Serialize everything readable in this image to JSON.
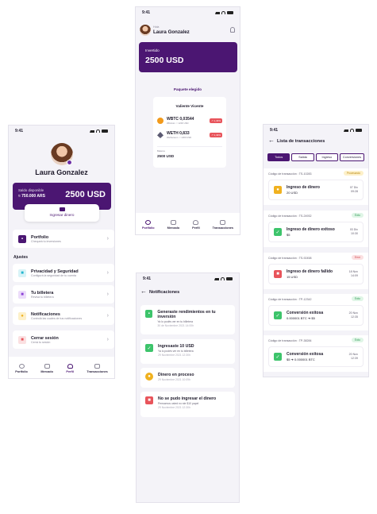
{
  "status_time": "9:41",
  "profile": {
    "name": "Laura Gonzalez",
    "balance_label": "Saldo disponible",
    "balance_ars": "≈ 750.000 ARS",
    "balance_usd": "2500 USD",
    "deposit_label": "Ingresar dinero",
    "portfolio_title": "Portfolio",
    "portfolio_sub": "Chequeá tu inversiones",
    "settings_label": "Ajustes",
    "menu": [
      {
        "title": "Privacidad y Seguridad",
        "sub": "Configurá la seguridad de tu cuenta",
        "color": "#21b5cf"
      },
      {
        "title": "Tu billetera",
        "sub": "Revisá tu billetera",
        "color": "#8a3fd6"
      },
      {
        "title": "Notificaciones",
        "sub": "Controlá las cuales de tus notificaciones",
        "color": "#f0b11f"
      },
      {
        "title": "Cerrar sesión",
        "sub": "Cerrá tu sesión",
        "color": "#e8545b"
      }
    ],
    "tabs": [
      "Portfolio",
      "Mercado",
      "Perfil",
      "Transacciones"
    ]
  },
  "portfolio": {
    "greeting": "Hola",
    "name": "Laura Gonzalez",
    "invested_label": "Invertido",
    "invested_value": "2500 USD",
    "package_label": "Paquete elegido",
    "package_name": "Valiente Vicente",
    "assets": [
      {
        "symbol": "WBTC",
        "name": "Wbitcoin",
        "amount": "0,03544",
        "usd": "≈ 1200 USD",
        "change": "1,43%",
        "color": "#f29a1b"
      },
      {
        "symbol": "WETH",
        "name": "Wethereum",
        "amount": "0,833",
        "usd": "≈ 1300 USD",
        "change": "1,43%",
        "color": "#5b5a72"
      }
    ],
    "total_label": "Balance",
    "total": "2500 USD",
    "tabs": [
      "Portfolio",
      "Mercado",
      "Perfil",
      "Transacciones"
    ]
  },
  "notifications": {
    "title": "Notificaciones",
    "items": [
      {
        "title": "Generaste rendimientos en tu inversión",
        "sub": "Ya lo podés ver en tu billetera",
        "date": "30 de Noviembre 2021 14:00h",
        "color": "#3dc46b"
      },
      {
        "title": "Ingresaste 10 USD",
        "sub": "Ya lo podés ver en tu billetera",
        "date": "29 Noviembre 2021 12:30h",
        "color": "#3dc46b"
      },
      {
        "title": "Dinero en proceso",
        "sub": "",
        "date": "29 Noviembre 2021 10:09h",
        "color": "#f0b11f"
      },
      {
        "title": "No se pudo ingresar el dinero",
        "sub": "Pensamos usted no ste $10 papel",
        "date": "29 Noviembre 2021 12:30h",
        "color": "#e8545b"
      }
    ]
  },
  "transactions": {
    "title": "Lista de transacciones",
    "filters": [
      "Todos",
      "Salida",
      "Ingreso",
      "Conversiones"
    ],
    "items": [
      {
        "code": "Código de transacción : TS-10283",
        "badge": "Procesando",
        "badge_bg": "#fdf0c9",
        "badge_fg": "#b9870c",
        "title": "Ingreso de dinero",
        "amount": "20 USD",
        "date1": "07 Dic",
        "date2": "09:28",
        "color": "#f0b11f"
      },
      {
        "code": "Código de transacción : TS-24932",
        "badge": "Éxito",
        "badge_bg": "#dff5e6",
        "badge_fg": "#2f9c55",
        "title": "Ingreso de dinero exitoso",
        "amount": "$5",
        "date1": "03 Dic",
        "date2": "10:30",
        "color": "#3dc46b"
      },
      {
        "code": "Código de transacción : TS-92458",
        "badge": "Error",
        "badge_bg": "#fbe0e1",
        "badge_fg": "#d14047",
        "title": "Ingreso de dinero fallido",
        "amount": "15 USD",
        "date1": "18 Nov",
        "date2": "14:09",
        "color": "#e8545b"
      },
      {
        "code": "Código de transacción : TP-12342",
        "badge": "Éxito",
        "badge_bg": "#dff5e6",
        "badge_fg": "#2f9c55",
        "title": "Conversión exitosa",
        "amount": "0.000001 BTC  ➜  $5",
        "date1": "20 Nov",
        "date2": "12:35",
        "color": "#3dc46b"
      },
      {
        "code": "Código de transacción : TP-38284",
        "badge": "Éxito",
        "badge_bg": "#dff5e6",
        "badge_fg": "#2f9c55",
        "title": "Conversión exitosa",
        "amount": "$5  ➜  0.000001 BTC",
        "date1": "20 Nov",
        "date2": "12:39",
        "color": "#3dc46b"
      }
    ]
  }
}
